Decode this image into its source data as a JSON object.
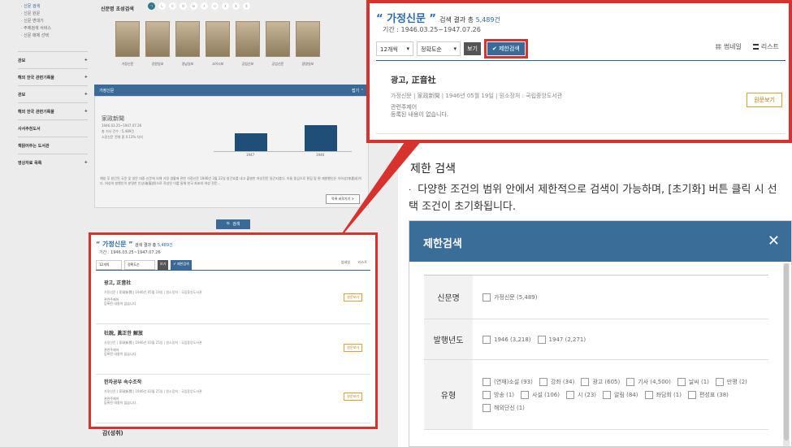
{
  "sidebar": {
    "subs": [
      "· 신문 검색",
      "· 신문 원문",
      "· 신문 변대기",
      "· 주제검색 서비스",
      "· 신문 매체 선택"
    ],
    "menus": [
      {
        "label": "관보",
        "sign": "+"
      },
      {
        "label": "해외 한국 관련기록물",
        "sign": "+"
      },
      {
        "label": "관보",
        "sign": "+"
      },
      {
        "label": "해외 한국 관련기록물",
        "sign": "+"
      },
      {
        "label": "사서추천도서",
        "sign": ""
      },
      {
        "label": "책읽어주는 도서관",
        "sign": ""
      },
      {
        "label": "영상자료 목록",
        "sign": "+"
      }
    ]
  },
  "bg_page": {
    "title": "신문명 초성검색",
    "initials": [
      "ㄱ",
      "ㄴ",
      "ㄷ",
      "ㅁ",
      "ㅂ",
      "ㅅ",
      "ㅇ",
      "ㅈ",
      "ㅊ",
      "ㅎ"
    ],
    "books": [
      "가정신문",
      "강원일보",
      "경남일보",
      "고려시보",
      "공립신보",
      "공업신문",
      "광명일보"
    ],
    "panel_title": "가정신문",
    "panel_toggle": "접기 ⌃",
    "paper_name": "家政新聞",
    "paper_info": "1946.03.25~1947.07.26\n총 기사 건수 : 5,489건\n소장신문 전체 중 0.13% 차지",
    "chart_labels": [
      "1947",
      "1946"
    ],
    "panel_desc": "해방 후 창간된 국문 및 영문 대중 신문에 의해 가정 생활에 관한 가정신문 1946년 3월 22일 창간호를 내고 출발한 여성전문 일간지였다. 이들 중심으로 편집 및 편 제발행인은 이하성(李夏成)이다. 여성의 발행인이 분명한 인상(崔憲邦)으로 작성된 이를 통해 한국 최초의 여성 전문...",
    "panel_btn": "목록 바로가기 >",
    "search_btn": "🔍 검색",
    "bottom_fragment": "감(성취)"
  },
  "small_result": {
    "quote": "“ 가정신문 ”",
    "count_prefix": "검색 결과 총",
    "count": "5,489건",
    "period": "기간 : 1946.03.25~1947.07.26",
    "per_page": "12개씩",
    "sort": "정확도순",
    "view": "보기",
    "limit": "✔ 제한검색",
    "thumbnail": "썸네일",
    "list": "리스트",
    "items": [
      {
        "title": "광고, 正音社",
        "meta": "가정신문  |  家政新聞  |  1946년 05월 19일  |  원소장처 : 국립중앙도서관",
        "desc": "관련주제어\n등록된 내용이 없습니다.",
        "btn": "원문보기"
      },
      {
        "title": "社說, 眞正한 解放",
        "meta": "가정신문  |  家政新聞  |  1946년 03월 25일  |  원소장처 : 국립중앙도서관",
        "desc": "관련주제어\n등록된 내용이 없습니다.",
        "btn": "원문보기"
      },
      {
        "title": "한자공부 속수조작",
        "meta": "가정신문  |  家政新聞  |  1946년 03월 25일  |  원소장처 : 국립중앙도서관",
        "desc": "관련주제어\n등록된 내용이 없습니다.",
        "btn": "원문보기"
      }
    ]
  },
  "big_result": {
    "quote": "“ 가정신문 ”",
    "count_prefix": "검색 결과 총",
    "count": "5,489건",
    "period": "기간 : 1946.03.25~1947.07.26",
    "per_page": "12개씩",
    "sort": "정확도순",
    "view": "보기",
    "limit": "✔ 제한검색",
    "thumbnail": "썸네일",
    "list": "리스트",
    "item_title": "광고, 正音社",
    "item_meta": "가정신문  |  家政新聞  |  1946년 05월 19일  |  원소장처 : 국립중앙도서관",
    "item_desc": "관련주제어\n등록된 내용이 없습니다.",
    "item_btn": "원문보기"
  },
  "description": {
    "title": "제한 검색",
    "text": "다양한 조건의 범위 안에서 제한적으로 검색이 가능하며, [초기화] 버튼 클릭 시 선택 조건이 초기화됩니다."
  },
  "modal": {
    "title": "제한검색",
    "rows": [
      {
        "label": "신문명",
        "options": [
          "가정신문 (5,489)"
        ]
      },
      {
        "label": "발행년도",
        "options": [
          "1946 (3,218)",
          "1947 (2,271)"
        ]
      },
      {
        "label": "유형",
        "options": [
          "(연재)소설 (93)",
          "강좌 (34)",
          "광고 (605)",
          "기사 (4,500)",
          "날씨 (1)",
          "만평 (2)",
          "방송 (1)",
          "사설 (106)",
          "시 (23)",
          "알림 (84)",
          "좌담회 (1)",
          "편성표 (38)",
          "해외단신 (1)"
        ]
      }
    ]
  },
  "colors": {
    "accent": "#3b6d99",
    "highlight": "#d8322e",
    "link": "#2b6cb0"
  }
}
